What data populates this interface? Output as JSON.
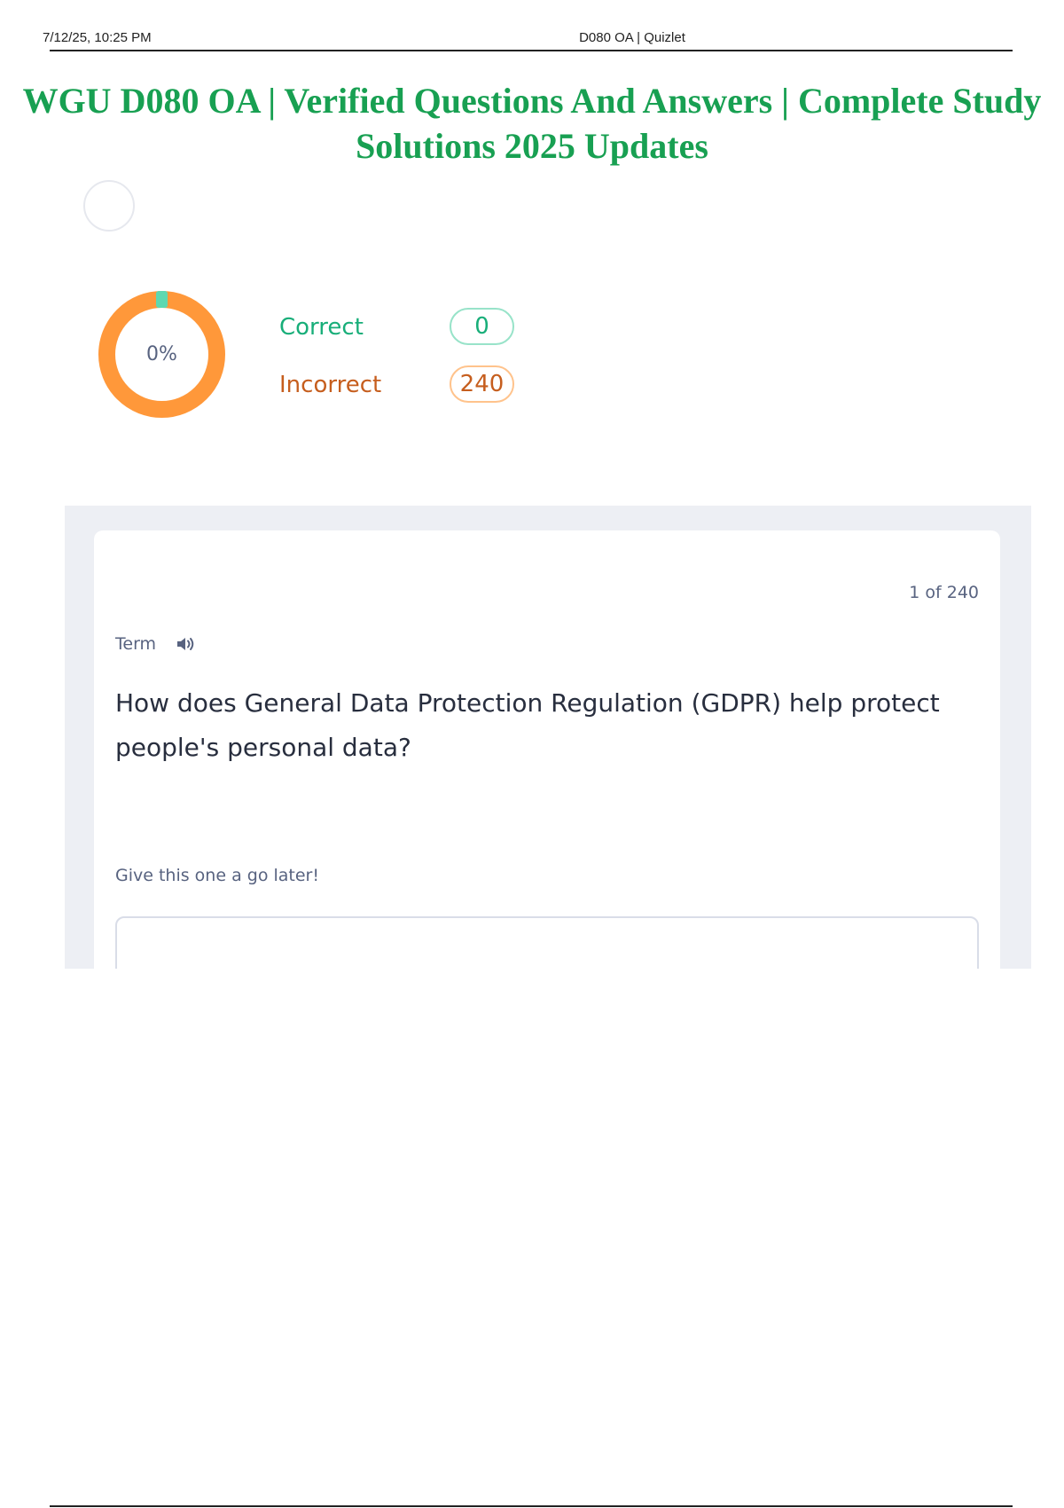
{
  "print_header": {
    "date": "7/12/25, 10:25 PM",
    "page_title": "D080 OA | Quizlet"
  },
  "document_title": "WGU D080 OA | Verified Questions And Answers | Complete Study Solutions 2025 Updates",
  "progress": {
    "percent_label": "0%",
    "correct_fraction": 0,
    "correct_label": "Correct",
    "correct_count": "0",
    "incorrect_label": "Incorrect",
    "incorrect_count": "240"
  },
  "card": {
    "counter": "1 of 240",
    "side_label": "Term",
    "question": "How does General Data Protection Regulation (GDPR) help protect people's personal data?",
    "hint": "Give this one a go later!",
    "audio_icon": "speaker-icon"
  },
  "colors": {
    "title_green": "#18a052",
    "correct_teal": "#18ae79",
    "incorrect_orange": "#c65e1e",
    "donut_orange": "#ff983a",
    "donut_marker": "#5ed8b0",
    "panel_gray": "#edeff4"
  }
}
